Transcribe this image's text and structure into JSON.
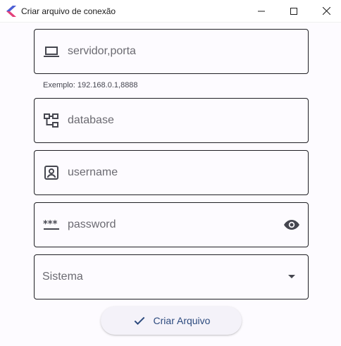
{
  "window": {
    "title": "Criar arquivo de conexão"
  },
  "form": {
    "server": {
      "placeholder": "servidor,porta",
      "helper": "Exemplo: 192.168.0.1,8888",
      "icon": "laptop-icon"
    },
    "database": {
      "placeholder": "database",
      "icon": "schema-icon"
    },
    "username": {
      "placeholder": "username",
      "icon": "account-box-icon"
    },
    "password": {
      "placeholder": "password",
      "icon": "password-icon",
      "toggle_icon": "eye-icon"
    },
    "system": {
      "label": "Sistema",
      "icon": "arrow-drop-down-icon"
    },
    "submit": {
      "label": "Criar Arquivo",
      "icon": "check-icon"
    }
  },
  "colors": {
    "accent": "#2c4a7e",
    "border": "#1f1f24",
    "background": "#fdfbff",
    "placeholder": "#6b6a71"
  }
}
